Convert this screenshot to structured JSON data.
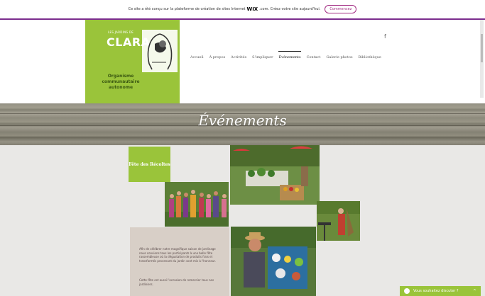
{
  "wix_banner": {
    "text_before": "Ce site a été conçu sur la plateforme de création de sites Internet",
    "logo": "WIX",
    "text_after": ".com. Créez votre site aujourd'hui.",
    "button_label": "Commencez"
  },
  "header": {
    "logo_small": "LES JARDINS DE",
    "logo_title": "CLARA",
    "org_line1": "Organisme",
    "org_line2": "communautaire",
    "org_line3": "autonome",
    "facebook_icon": "f",
    "nav": [
      {
        "label": "Accueil"
      },
      {
        "label": "À propos"
      },
      {
        "label": "Activités"
      },
      {
        "label": "S'impliquer"
      },
      {
        "label": "Événements"
      },
      {
        "label": "Contact"
      },
      {
        "label": "Galerie photos"
      },
      {
        "label": "Bibliothèque"
      }
    ]
  },
  "banner": {
    "title": "Événements"
  },
  "content": {
    "green_tile": "Fête des Récoltes",
    "paragraph1": "Afin de célébrer notre magnifique saison de jardinage nous convions tous les participants à une belle fête rassembleuse où la dégustation de produits frais et transformés provenant du jardin sont mis à l'honneur.",
    "paragraph2": "Cette fête est aussi l'occasion de remercier tous nos jardiniers."
  },
  "chat": {
    "label": "Vous souhaitez discuter ?",
    "icon": "chat-bubble-icon"
  },
  "colors": {
    "brand_green": "#9ac43a",
    "wix_purple": "#7b2d8e"
  }
}
